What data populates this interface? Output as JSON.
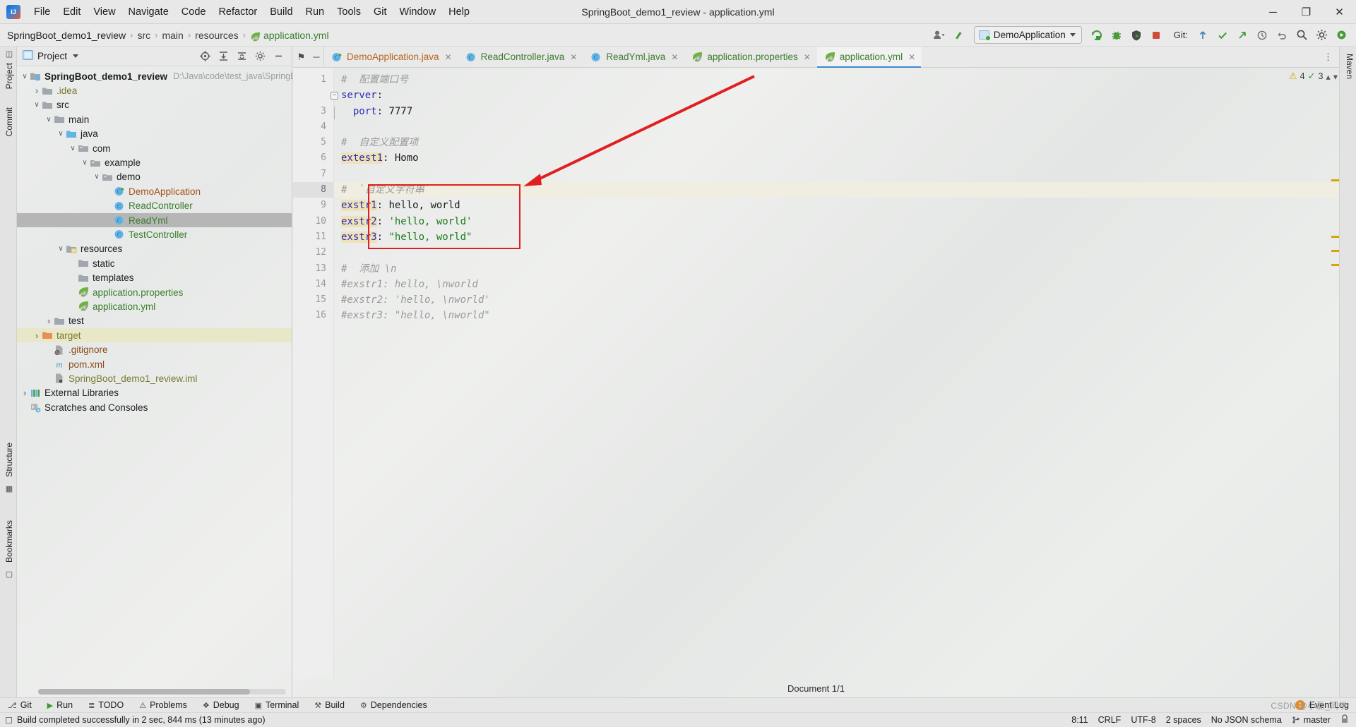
{
  "window": {
    "title": "SpringBoot_demo1_review - application.yml",
    "logo_icon": "intellij-idea-logo",
    "controls": [
      {
        "name": "minimize-button",
        "glyph": "─"
      },
      {
        "name": "maximize-button",
        "glyph": "❐"
      },
      {
        "name": "close-button",
        "glyph": "✕"
      }
    ]
  },
  "menu": [
    {
      "label": "File",
      "mnemonic": "F"
    },
    {
      "label": "Edit",
      "mnemonic": "E"
    },
    {
      "label": "View",
      "mnemonic": "V"
    },
    {
      "label": "Navigate",
      "mnemonic": "N"
    },
    {
      "label": "Code",
      "mnemonic": "C"
    },
    {
      "label": "Refactor",
      "mnemonic": "R"
    },
    {
      "label": "Build",
      "mnemonic": "B"
    },
    {
      "label": "Run",
      "mnemonic": "u"
    },
    {
      "label": "Tools",
      "mnemonic": "T"
    },
    {
      "label": "Git",
      "mnemonic": "G"
    },
    {
      "label": "Window",
      "mnemonic": "W"
    },
    {
      "label": "Help",
      "mnemonic": "H"
    }
  ],
  "breadcrumb": {
    "items": [
      "SpringBoot_demo1_review",
      "src",
      "main",
      "resources"
    ],
    "leaf": "application.yml",
    "leaf_icon": "spring-leaf-icon",
    "separator": "›"
  },
  "toolbar": {
    "account_icon": "user-account-icon",
    "updates_icon": "update-arrow-icon",
    "run_config": {
      "label": "DemoApplication",
      "icon": "run-configuration-icon",
      "dropdown_icon": "chevron-down-icon"
    },
    "run_icon": "run-icon",
    "debug_icon": "debug-bug-icon",
    "run_coverage_icon": "run-with-coverage-icon",
    "stop_icon": "stop-icon",
    "git_label": "Git:",
    "git_update_icon": "git-update-icon",
    "git_commit_icon": "git-commit-checkmark-icon",
    "git_push_icon": "git-push-icon",
    "history_icon": "history-clock-icon",
    "undo_icon": "undo-icon",
    "search_icon": "search-icon",
    "settings_icon": "gear-icon",
    "ide_status_icon": "ide-status-icon"
  },
  "left_strip": {
    "tabs": [
      {
        "label": "Project",
        "name": "tool-window-project"
      },
      {
        "label": "Commit",
        "name": "tool-window-commit"
      },
      {
        "label": "Structure",
        "name": "tool-window-structure"
      },
      {
        "label": "Bookmarks",
        "name": "tool-window-bookmarks"
      }
    ]
  },
  "right_strip": {
    "tabs": [
      {
        "label": "Maven",
        "name": "tool-window-maven"
      }
    ]
  },
  "project_panel": {
    "title": "Project",
    "view_icon": "project-view-icon",
    "dropdown_icon": "chevron-down-icon",
    "header_actions": [
      {
        "name": "select-opened-file-icon",
        "glyph": "⊕"
      },
      {
        "name": "expand-all-icon",
        "glyph": "≣"
      },
      {
        "name": "collapse-all-icon",
        "glyph": "≡"
      },
      {
        "name": "settings-gear-icon",
        "glyph": "⚙"
      },
      {
        "name": "hide-panel-icon",
        "glyph": "─"
      }
    ],
    "tree": [
      {
        "label": "SpringBoot_demo1_review",
        "path": "D:\\Java\\code\\test_java\\SpringBo",
        "depth": 0,
        "twisty": "open",
        "icon": "module-folder-icon",
        "style": "bold",
        "state": "normal"
      },
      {
        "label": ".idea",
        "depth": 1,
        "twisty": "closed",
        "icon": "folder-icon",
        "style": "olive",
        "state": "normal"
      },
      {
        "label": "src",
        "depth": 1,
        "twisty": "open",
        "icon": "folder-icon",
        "style": "plain",
        "state": "normal"
      },
      {
        "label": "main",
        "depth": 2,
        "twisty": "open",
        "icon": "folder-icon",
        "style": "plain",
        "state": "normal"
      },
      {
        "label": "java",
        "depth": 3,
        "twisty": "open",
        "icon": "source-folder-icon",
        "style": "plain",
        "state": "normal"
      },
      {
        "label": "com",
        "depth": 4,
        "twisty": "open",
        "icon": "package-icon",
        "style": "plain",
        "state": "normal"
      },
      {
        "label": "example",
        "depth": 5,
        "twisty": "open",
        "icon": "package-icon",
        "style": "plain",
        "state": "normal"
      },
      {
        "label": "demo",
        "depth": 6,
        "twisty": "open",
        "icon": "package-icon",
        "style": "plain",
        "state": "normal"
      },
      {
        "label": "DemoApplication",
        "depth": 7,
        "twisty": "none",
        "icon": "java-class-runnable-icon",
        "style": "orange",
        "state": "normal"
      },
      {
        "label": "ReadController",
        "depth": 7,
        "twisty": "none",
        "icon": "java-class-icon",
        "style": "green",
        "state": "normal"
      },
      {
        "label": "ReadYml",
        "depth": 7,
        "twisty": "none",
        "icon": "java-class-icon",
        "style": "green",
        "state": "selected"
      },
      {
        "label": "TestController",
        "depth": 7,
        "twisty": "none",
        "icon": "java-class-icon",
        "style": "green",
        "state": "normal"
      },
      {
        "label": "resources",
        "depth": 3,
        "twisty": "open",
        "icon": "resource-folder-icon",
        "style": "plain",
        "state": "normal"
      },
      {
        "label": "static",
        "depth": 4,
        "twisty": "none",
        "icon": "folder-icon",
        "style": "plain",
        "state": "normal"
      },
      {
        "label": "templates",
        "depth": 4,
        "twisty": "none",
        "icon": "folder-icon",
        "style": "plain",
        "state": "normal"
      },
      {
        "label": "application.properties",
        "depth": 4,
        "twisty": "none",
        "icon": "spring-leaf-icon",
        "style": "green",
        "state": "normal"
      },
      {
        "label": "application.yml",
        "depth": 4,
        "twisty": "none",
        "icon": "spring-leaf-icon",
        "style": "green",
        "state": "normal"
      },
      {
        "label": "test",
        "depth": 2,
        "twisty": "closed",
        "icon": "test-folder-icon",
        "style": "plain",
        "state": "normal"
      },
      {
        "label": "target",
        "depth": 1,
        "twisty": "closed",
        "icon": "excluded-folder-icon",
        "style": "olive",
        "state": "highlight"
      },
      {
        "label": ".gitignore",
        "depth": 2,
        "twisty": "none",
        "icon": "gitignore-file-icon",
        "style": "brown",
        "state": "normal"
      },
      {
        "label": "pom.xml",
        "depth": 2,
        "twisty": "none",
        "icon": "maven-file-icon",
        "style": "brown",
        "state": "normal"
      },
      {
        "label": "SpringBoot_demo1_review.iml",
        "depth": 2,
        "twisty": "none",
        "icon": "iml-file-icon",
        "style": "olive",
        "state": "normal"
      },
      {
        "label": "External Libraries",
        "depth": 0,
        "twisty": "closed",
        "icon": "external-libraries-icon",
        "style": "plain",
        "state": "normal"
      },
      {
        "label": "Scratches and Consoles",
        "depth": 0,
        "twisty": "none",
        "icon": "scratches-icon",
        "style": "plain",
        "state": "normal"
      }
    ]
  },
  "editor": {
    "tabs": [
      {
        "label": "DemoApplication.java",
        "icon": "java-class-runnable-icon",
        "color": "orange",
        "active": false,
        "closable": true
      },
      {
        "label": "ReadController.java",
        "icon": "java-class-icon",
        "color": "green",
        "active": false,
        "closable": true
      },
      {
        "label": "ReadYml.java",
        "icon": "java-class-icon",
        "color": "green",
        "active": false,
        "closable": true
      },
      {
        "label": "application.properties",
        "icon": "spring-leaf-icon",
        "color": "green",
        "active": false,
        "closable": true
      },
      {
        "label": "application.yml",
        "icon": "spring-leaf-icon",
        "color": "green",
        "active": true,
        "closable": true
      }
    ],
    "tab_actions": [
      {
        "name": "pin-tab-icon",
        "glyph": "⚑"
      },
      {
        "name": "hide-tabs-icon",
        "glyph": "─"
      }
    ],
    "more_icon": "more-vertical-icon",
    "inspection": {
      "warning_count": "4",
      "warning_icon": "warning-triangle-icon",
      "ok_count": "3",
      "ok_icon": "checkmark-icon",
      "prev_icon": "chevron-up-icon",
      "next_icon": "chevron-down-icon"
    },
    "lines": [
      {
        "n": "1",
        "tokens": [
          {
            "t": "#  配置端口号",
            "c": "cmt"
          }
        ]
      },
      {
        "n": "2",
        "tokens": [
          {
            "t": "server",
            "c": "key"
          },
          {
            "t": ":",
            "c": "plain"
          }
        ],
        "fold": "open"
      },
      {
        "n": "3",
        "tokens": [
          {
            "t": "  ",
            "c": "plain"
          },
          {
            "t": "port",
            "c": "key"
          },
          {
            "t": ": ",
            "c": "plain"
          },
          {
            "t": "7777",
            "c": "num"
          }
        ],
        "fold": "end"
      },
      {
        "n": "4",
        "tokens": []
      },
      {
        "n": "5",
        "tokens": [
          {
            "t": "#  自定义配置项",
            "c": "cmt"
          }
        ]
      },
      {
        "n": "6",
        "tokens": [
          {
            "t": "extest1",
            "c": "hlkey"
          },
          {
            "t": ": ",
            "c": "plain"
          },
          {
            "t": "Homo",
            "c": "plain"
          }
        ]
      },
      {
        "n": "7",
        "tokens": []
      },
      {
        "n": "8",
        "tokens": [
          {
            "t": "#  `自定义字符串`",
            "c": "cmt"
          }
        ],
        "current": true
      },
      {
        "n": "9",
        "tokens": [
          {
            "t": "exstr1",
            "c": "hlkey"
          },
          {
            "t": ": ",
            "c": "plain"
          },
          {
            "t": "hello, world",
            "c": "plain"
          }
        ]
      },
      {
        "n": "10",
        "tokens": [
          {
            "t": "exstr2",
            "c": "hlkey"
          },
          {
            "t": ": ",
            "c": "plain"
          },
          {
            "t": "'hello, world'",
            "c": "str"
          }
        ]
      },
      {
        "n": "11",
        "tokens": [
          {
            "t": "exstr3",
            "c": "hlkey"
          },
          {
            "t": ": ",
            "c": "plain"
          },
          {
            "t": "\"hello, world\"",
            "c": "str"
          }
        ]
      },
      {
        "n": "12",
        "tokens": []
      },
      {
        "n": "13",
        "tokens": [
          {
            "t": "#  添加 \\n",
            "c": "cmt"
          }
        ]
      },
      {
        "n": "14",
        "tokens": [
          {
            "t": "#exstr1: hello, \\nworld",
            "c": "cmt"
          }
        ]
      },
      {
        "n": "15",
        "tokens": [
          {
            "t": "#exstr2: 'hello, \\nworld'",
            "c": "cmt"
          }
        ]
      },
      {
        "n": "16",
        "tokens": [
          {
            "t": "#exstr3: \"hello, \\nworld\"",
            "c": "cmt"
          }
        ]
      }
    ],
    "document_status": "Document 1/1",
    "annotation": {
      "box_color": "#e02020",
      "arrow_color": "#e02020",
      "shape": "red-rectangle-with-arrow"
    }
  },
  "bottom_bar": {
    "items": [
      {
        "label": "Git",
        "icon": "git-branch-icon",
        "name": "tool-window-git"
      },
      {
        "label": "Run",
        "icon": "run-triangle-icon",
        "name": "tool-window-run"
      },
      {
        "label": "TODO",
        "icon": "todo-list-icon",
        "name": "tool-window-todo"
      },
      {
        "label": "Problems",
        "icon": "problems-icon",
        "name": "tool-window-problems"
      },
      {
        "label": "Debug",
        "icon": "debug-bug-icon",
        "name": "tool-window-debug"
      },
      {
        "label": "Terminal",
        "icon": "terminal-icon",
        "name": "tool-window-terminal"
      },
      {
        "label": "Build",
        "icon": "build-hammer-icon",
        "name": "tool-window-build"
      },
      {
        "label": "Dependencies",
        "icon": "dependencies-icon",
        "name": "tool-window-dependencies"
      }
    ],
    "event_log": {
      "label": "Event Log",
      "count": "1",
      "icon": "event-log-icon"
    }
  },
  "status_bar": {
    "message": "Build completed successfully in 2 sec, 844 ms (13 minutes ago)",
    "message_icon": "build-status-icon",
    "caret_position": "8:11",
    "line_separator": "CRLF",
    "encoding": "UTF-8",
    "indent": "2 spaces",
    "schema": "No JSON schema",
    "branch": "master",
    "branch_icon": "git-branch-icon",
    "lock_icon": "read-only-lock-icon"
  },
  "watermark": "CSDN @小磊_同学"
}
